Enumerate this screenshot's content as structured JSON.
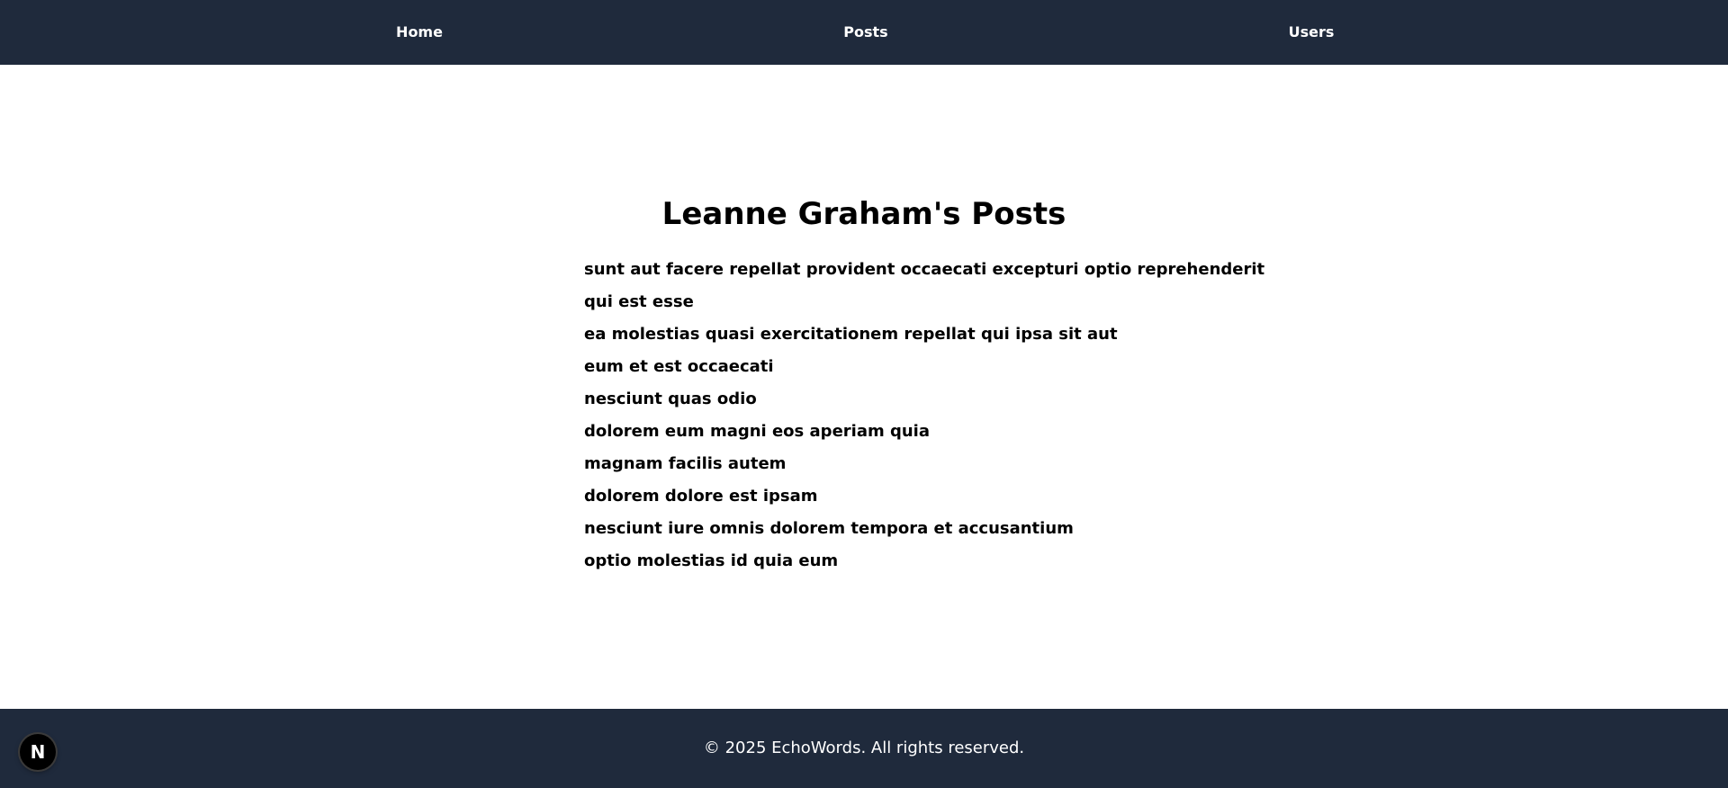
{
  "nav": {
    "home": "Home",
    "posts": "Posts",
    "users": "Users"
  },
  "page": {
    "title": "Leanne Graham's Posts"
  },
  "posts": [
    "sunt aut facere repellat provident occaecati excepturi optio reprehenderit",
    "qui est esse",
    "ea molestias quasi exercitationem repellat qui ipsa sit aut",
    "eum et est occaecati",
    "nesciunt quas odio",
    "dolorem eum magni eos aperiam quia",
    "magnam facilis autem",
    "dolorem dolore est ipsam",
    "nesciunt iure omnis dolorem tempora et accusantium",
    "optio molestias id quia eum"
  ],
  "footer": {
    "copyright": "© 2025 EchoWords. All rights reserved."
  },
  "devtools": {
    "icon": "nextjs-logo-icon",
    "glyph": "N"
  },
  "colors": {
    "nav_background": "#1f2a3c",
    "footer_background": "#1f2a3c",
    "page_background": "#ffffff",
    "text": "#000000",
    "nav_text": "#ffffff"
  }
}
